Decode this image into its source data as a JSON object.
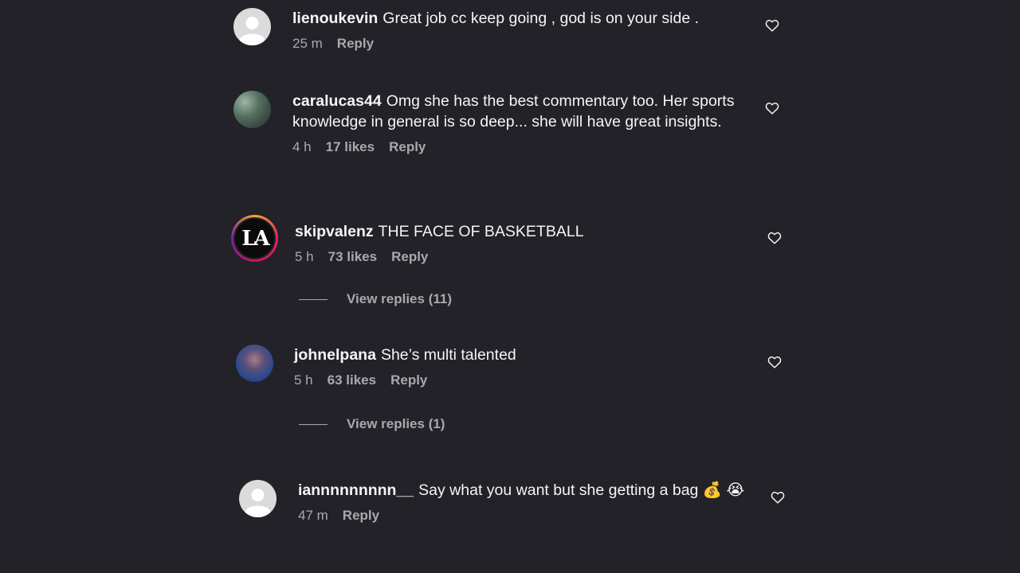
{
  "comments": [
    {
      "username": "lienoukevin",
      "text": "Great job cc keep going , god is on your side .",
      "time": "25 m",
      "likes": "",
      "reply": "Reply",
      "avatar": "default-user-icon"
    },
    {
      "username": "caralucas44",
      "text": "Omg she has the best commentary too. Her sports knowledge in general is so deep... she will have great insights.",
      "time": "4 h",
      "likes": "17 likes",
      "reply": "Reply",
      "avatar": "photo"
    },
    {
      "username": "skipvalenz",
      "text": "THE FACE OF BASKETBALL",
      "time": "5 h",
      "likes": "73 likes",
      "reply": "Reply",
      "avatar": "la-logo",
      "view_replies": "View replies (11)"
    },
    {
      "username": "johnelpana",
      "text": "She’s multi talented",
      "time": "5 h",
      "likes": "63 likes",
      "reply": "Reply",
      "avatar": "photo",
      "view_replies": "View replies (1)"
    },
    {
      "username": "iannnnnnnnn__",
      "text": "Say what you want but she getting a bag 💰 😭",
      "time": "47 m",
      "likes": "",
      "reply": "Reply",
      "avatar": "default-user-icon"
    }
  ],
  "avatar_logo_text": "LA",
  "colors": {
    "background": "#222228",
    "text": "#f5f5f5",
    "muted": "#a8a8ad"
  }
}
